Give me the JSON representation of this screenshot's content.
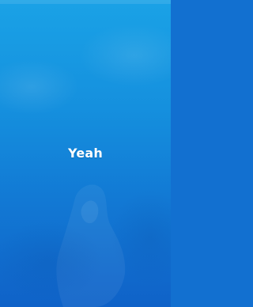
{
  "screen": {
    "message": "Yeah"
  },
  "colors": {
    "gradient_top": "#1aa2e6",
    "gradient_mid": "#1590de",
    "gradient_bottom": "#0f62c8",
    "text": "#ffffff"
  }
}
